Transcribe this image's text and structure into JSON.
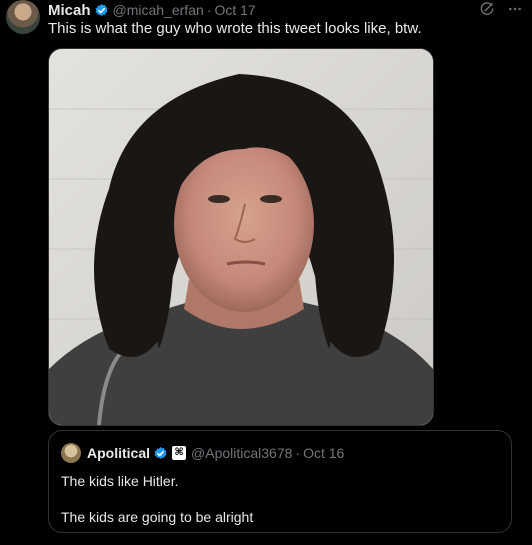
{
  "tweet": {
    "author_name": "Micah",
    "author_handle": "@micah_erfan",
    "separator": "·",
    "date": "Oct 17",
    "text": "This is what the guy who wrote this tweet looks like, btw.",
    "icons": {
      "verified": "verified-badge-icon",
      "grok": "grok-icon",
      "more": "more-options-icon"
    },
    "accent_color": "#1d9bf0"
  },
  "quoted_tweet": {
    "author_name": "Apolitical",
    "author_handle": "@Apolitical3678",
    "separator": "·",
    "date": "Oct 16",
    "affiliate_badge": "⌘",
    "line1": "The kids like Hitler.",
    "line2": "The kids are going to be alright"
  }
}
